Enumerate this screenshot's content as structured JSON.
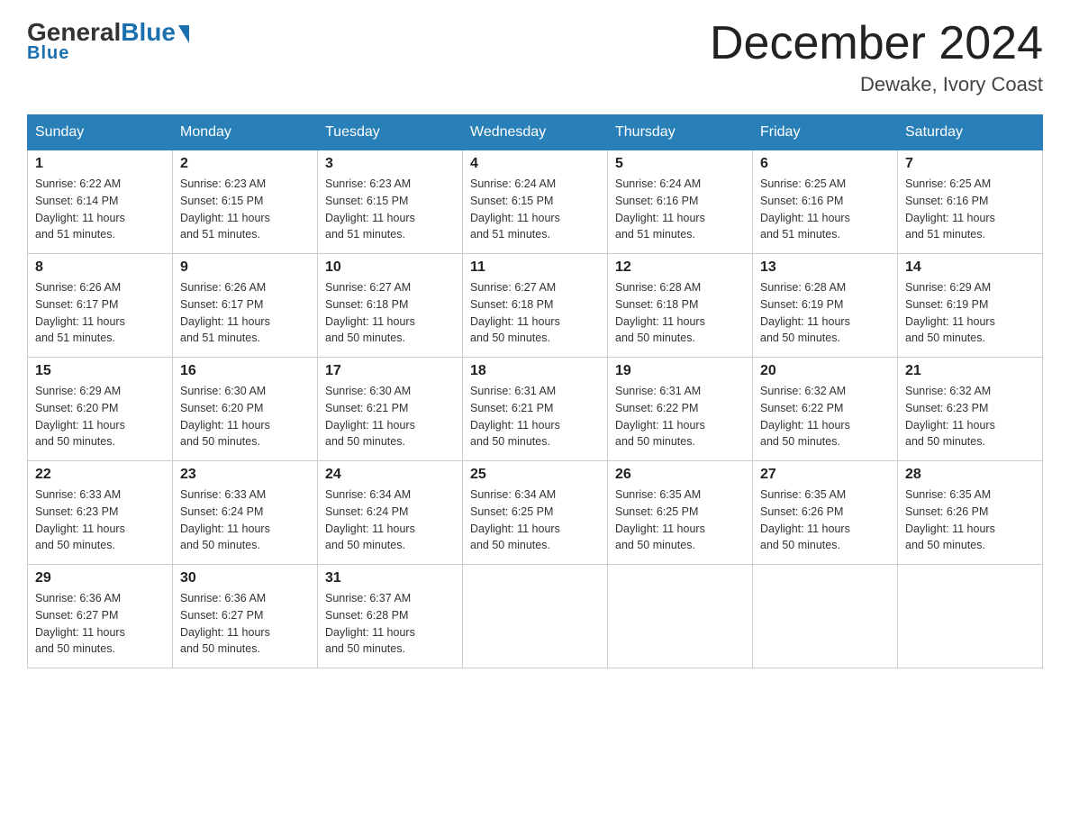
{
  "header": {
    "logo_general": "General",
    "logo_blue": "Blue",
    "month_title": "December 2024",
    "location": "Dewake, Ivory Coast"
  },
  "days_of_week": [
    "Sunday",
    "Monday",
    "Tuesday",
    "Wednesday",
    "Thursday",
    "Friday",
    "Saturday"
  ],
  "weeks": [
    [
      {
        "day": "1",
        "sunrise": "6:22 AM",
        "sunset": "6:14 PM",
        "daylight": "11 hours and 51 minutes."
      },
      {
        "day": "2",
        "sunrise": "6:23 AM",
        "sunset": "6:15 PM",
        "daylight": "11 hours and 51 minutes."
      },
      {
        "day": "3",
        "sunrise": "6:23 AM",
        "sunset": "6:15 PM",
        "daylight": "11 hours and 51 minutes."
      },
      {
        "day": "4",
        "sunrise": "6:24 AM",
        "sunset": "6:15 PM",
        "daylight": "11 hours and 51 minutes."
      },
      {
        "day": "5",
        "sunrise": "6:24 AM",
        "sunset": "6:16 PM",
        "daylight": "11 hours and 51 minutes."
      },
      {
        "day": "6",
        "sunrise": "6:25 AM",
        "sunset": "6:16 PM",
        "daylight": "11 hours and 51 minutes."
      },
      {
        "day": "7",
        "sunrise": "6:25 AM",
        "sunset": "6:16 PM",
        "daylight": "11 hours and 51 minutes."
      }
    ],
    [
      {
        "day": "8",
        "sunrise": "6:26 AM",
        "sunset": "6:17 PM",
        "daylight": "11 hours and 51 minutes."
      },
      {
        "day": "9",
        "sunrise": "6:26 AM",
        "sunset": "6:17 PM",
        "daylight": "11 hours and 51 minutes."
      },
      {
        "day": "10",
        "sunrise": "6:27 AM",
        "sunset": "6:18 PM",
        "daylight": "11 hours and 50 minutes."
      },
      {
        "day": "11",
        "sunrise": "6:27 AM",
        "sunset": "6:18 PM",
        "daylight": "11 hours and 50 minutes."
      },
      {
        "day": "12",
        "sunrise": "6:28 AM",
        "sunset": "6:18 PM",
        "daylight": "11 hours and 50 minutes."
      },
      {
        "day": "13",
        "sunrise": "6:28 AM",
        "sunset": "6:19 PM",
        "daylight": "11 hours and 50 minutes."
      },
      {
        "day": "14",
        "sunrise": "6:29 AM",
        "sunset": "6:19 PM",
        "daylight": "11 hours and 50 minutes."
      }
    ],
    [
      {
        "day": "15",
        "sunrise": "6:29 AM",
        "sunset": "6:20 PM",
        "daylight": "11 hours and 50 minutes."
      },
      {
        "day": "16",
        "sunrise": "6:30 AM",
        "sunset": "6:20 PM",
        "daylight": "11 hours and 50 minutes."
      },
      {
        "day": "17",
        "sunrise": "6:30 AM",
        "sunset": "6:21 PM",
        "daylight": "11 hours and 50 minutes."
      },
      {
        "day": "18",
        "sunrise": "6:31 AM",
        "sunset": "6:21 PM",
        "daylight": "11 hours and 50 minutes."
      },
      {
        "day": "19",
        "sunrise": "6:31 AM",
        "sunset": "6:22 PM",
        "daylight": "11 hours and 50 minutes."
      },
      {
        "day": "20",
        "sunrise": "6:32 AM",
        "sunset": "6:22 PM",
        "daylight": "11 hours and 50 minutes."
      },
      {
        "day": "21",
        "sunrise": "6:32 AM",
        "sunset": "6:23 PM",
        "daylight": "11 hours and 50 minutes."
      }
    ],
    [
      {
        "day": "22",
        "sunrise": "6:33 AM",
        "sunset": "6:23 PM",
        "daylight": "11 hours and 50 minutes."
      },
      {
        "day": "23",
        "sunrise": "6:33 AM",
        "sunset": "6:24 PM",
        "daylight": "11 hours and 50 minutes."
      },
      {
        "day": "24",
        "sunrise": "6:34 AM",
        "sunset": "6:24 PM",
        "daylight": "11 hours and 50 minutes."
      },
      {
        "day": "25",
        "sunrise": "6:34 AM",
        "sunset": "6:25 PM",
        "daylight": "11 hours and 50 minutes."
      },
      {
        "day": "26",
        "sunrise": "6:35 AM",
        "sunset": "6:25 PM",
        "daylight": "11 hours and 50 minutes."
      },
      {
        "day": "27",
        "sunrise": "6:35 AM",
        "sunset": "6:26 PM",
        "daylight": "11 hours and 50 minutes."
      },
      {
        "day": "28",
        "sunrise": "6:35 AM",
        "sunset": "6:26 PM",
        "daylight": "11 hours and 50 minutes."
      }
    ],
    [
      {
        "day": "29",
        "sunrise": "6:36 AM",
        "sunset": "6:27 PM",
        "daylight": "11 hours and 50 minutes."
      },
      {
        "day": "30",
        "sunrise": "6:36 AM",
        "sunset": "6:27 PM",
        "daylight": "11 hours and 50 minutes."
      },
      {
        "day": "31",
        "sunrise": "6:37 AM",
        "sunset": "6:28 PM",
        "daylight": "11 hours and 50 minutes."
      },
      null,
      null,
      null,
      null
    ]
  ]
}
